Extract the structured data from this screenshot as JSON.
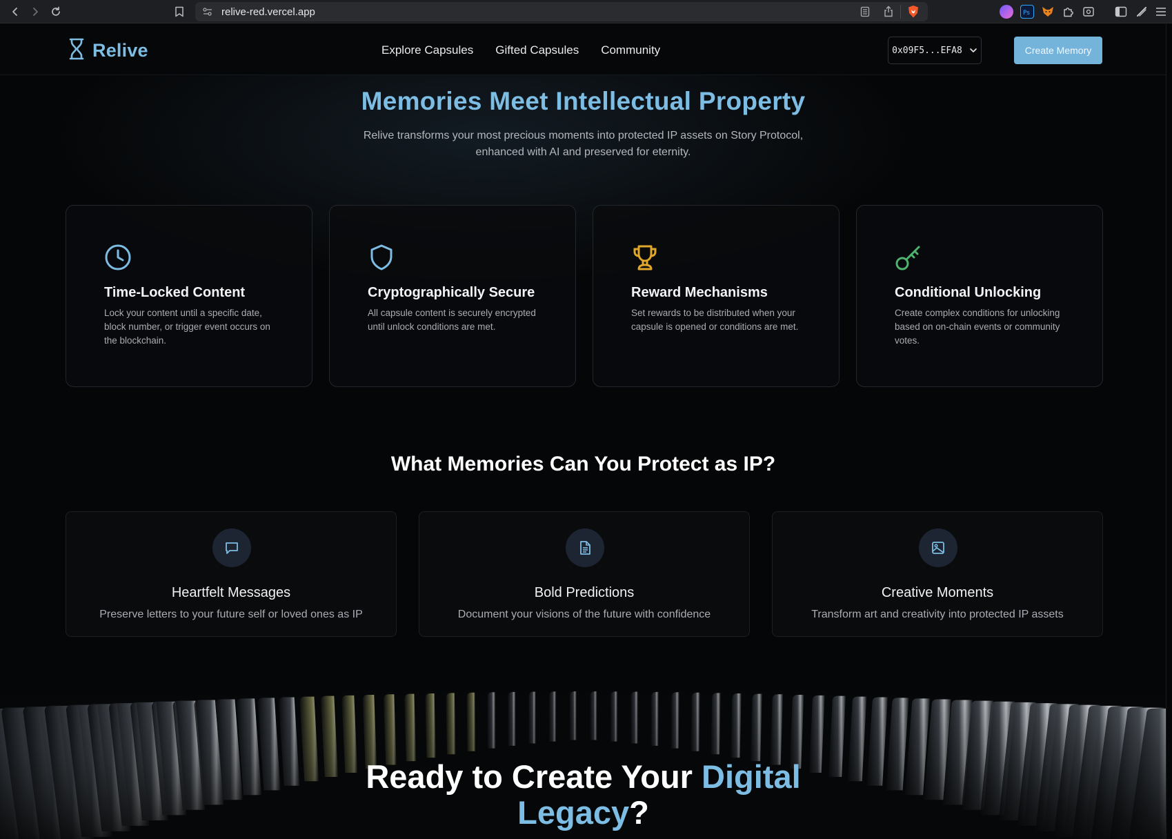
{
  "browser": {
    "url": "relive-red.vercel.app"
  },
  "header": {
    "logo_text": "Relive",
    "nav": [
      "Explore Capsules",
      "Gifted Capsules",
      "Community"
    ],
    "wallet_address": "0x09F5...EFA8",
    "create_button": "Create Memory"
  },
  "hero": {
    "title": "Memories Meet Intellectual Property",
    "subtitle_line1": "Relive transforms your most precious moments into protected IP assets on Story Protocol,",
    "subtitle_line2": "enhanced with AI and preserved for eternity."
  },
  "features": [
    {
      "icon": "clock-icon",
      "color": "#7dbde3",
      "title": "Time-Locked Content",
      "text": "Lock your content until a specific date, block number, or trigger event occurs on the blockchain."
    },
    {
      "icon": "shield-icon",
      "color": "#7dbde3",
      "title": "Cryptographically Secure",
      "text": "All capsule content is securely encrypted until unlock conditions are met."
    },
    {
      "icon": "trophy-icon",
      "color": "#e1a72b",
      "title": "Reward Mechanisms",
      "text": "Set rewards to be distributed when your capsule is opened or conditions are met."
    },
    {
      "icon": "key-icon",
      "color": "#4eb36e",
      "title": "Conditional Unlocking",
      "text": "Create complex conditions for unlocking based on on-chain events or community votes."
    }
  ],
  "use_cases": {
    "title": "What Memories Can You Protect as IP?",
    "items": [
      {
        "icon": "message-icon",
        "title": "Heartfelt Messages",
        "text": "Preserve letters to your future self or loved ones as IP"
      },
      {
        "icon": "document-icon",
        "title": "Bold Predictions",
        "text": "Document your visions of the future with confidence"
      },
      {
        "icon": "image-icon",
        "title": "Creative Moments",
        "text": "Transform art and creativity into protected IP assets"
      }
    ]
  },
  "cta": {
    "title_part1": "Ready to Create Your ",
    "title_highlight1": "Digital",
    "title_highlight2": "Legacy",
    "title_end": "?"
  },
  "colors": {
    "accent": "#7dbde3",
    "button": "#74b4db",
    "background": "#050607"
  }
}
